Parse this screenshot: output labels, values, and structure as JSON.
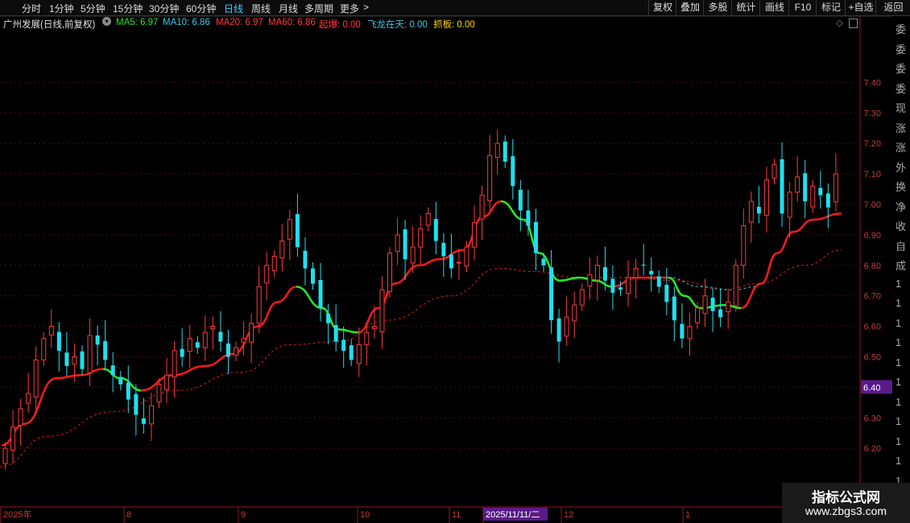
{
  "toolbar": {
    "timeframes": [
      "分时",
      "1分钟",
      "5分钟",
      "15分钟",
      "30分钟",
      "60分钟",
      "日线",
      "周线",
      "月线",
      "多周期",
      "更多"
    ],
    "active_timeframe": "日线",
    "more_arrow": ">",
    "actions": [
      "复权",
      "叠加",
      "多股",
      "统计",
      "画线",
      "F10",
      "标记",
      "+自选",
      "返回"
    ]
  },
  "stock": {
    "name": "广州发展(日线,前复权)",
    "indicators": [
      {
        "label": "MA5: 6.97",
        "color": "#2fe02f"
      },
      {
        "label": "MA10: 6.86",
        "color": "#3cc8e6"
      },
      {
        "label": "MA20: 6.97",
        "color": "#ff3a3a"
      },
      {
        "label": "MA60: 6.86",
        "color": "#ff3a3a"
      },
      {
        "label": "起爆: 0.00",
        "color": "#ff3a3a"
      },
      {
        "label": "飞龙在天: 0.00",
        "color": "#3cc8e6"
      },
      {
        "label": "抓板: 0.00",
        "color": "#ffd700"
      }
    ]
  },
  "price_axis": {
    "ticks": [
      "7.40",
      "7.30",
      "7.20",
      "7.10",
      "7.00",
      "6.90",
      "6.80",
      "6.70",
      "6.60",
      "6.50",
      "6.40",
      "6.30",
      "6.20"
    ],
    "current_price": "6.40"
  },
  "date_axis": {
    "labels": [
      "2025年",
      "8",
      "9",
      "10",
      "11",
      "2025/11/11/二",
      "12",
      "1"
    ]
  },
  "right_panel": {
    "glyphs": [
      "委",
      "委",
      "委",
      "委",
      "现",
      "涨",
      "涨",
      "外",
      "换",
      "净",
      "收",
      "自",
      "成",
      "1",
      "1",
      "1",
      "1",
      "1",
      "1",
      "1",
      "1",
      "1",
      "1",
      "1"
    ]
  },
  "watermark": {
    "title": "指标公式网",
    "url": "www.zbgs3.com"
  },
  "colors": {
    "up": "#ff3a3a",
    "down": "#1ee0f0",
    "ma_up": "#ff1a1a",
    "ma_down": "#22ee22",
    "current_price_bg": "#5a1a8a"
  }
}
